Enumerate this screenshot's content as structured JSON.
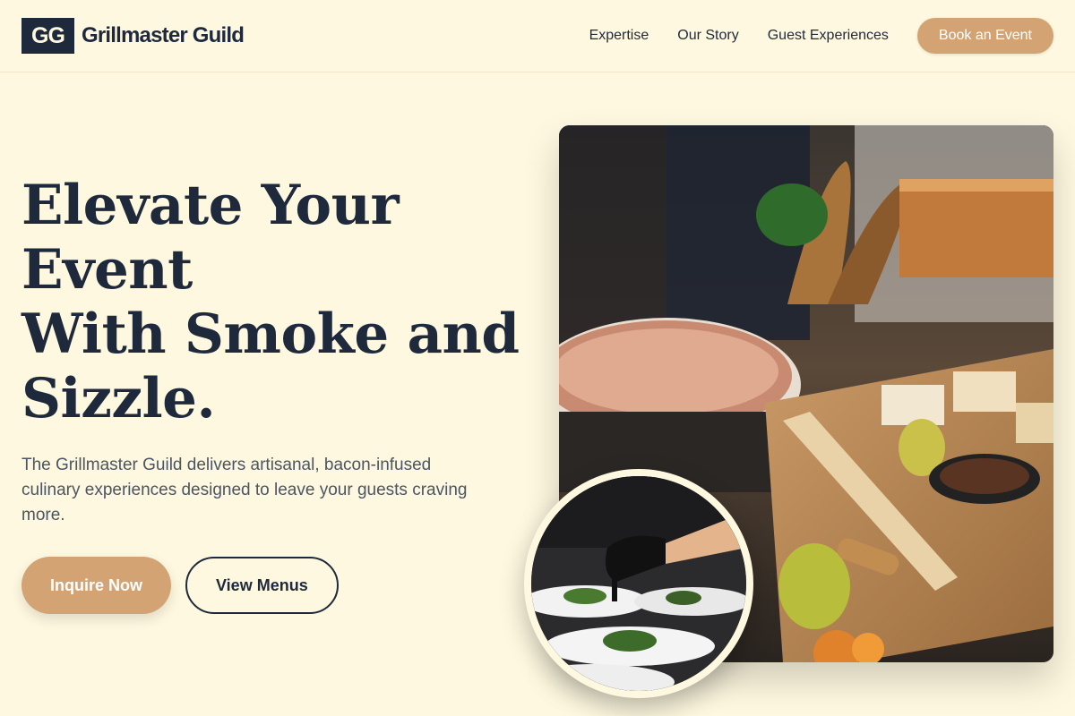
{
  "header": {
    "logo_text": "GG",
    "brand_name": "Grillmaster Guild",
    "nav": [
      "Expertise",
      "Our Story",
      "Guest Experiences"
    ],
    "cta": "Book an Event"
  },
  "hero": {
    "title_lines": [
      "Elevate Your",
      "Event",
      "With Smoke and",
      "Sizzle."
    ],
    "subtitle": "The Grillmaster Guild delivers artisanal, bacon-infused culinary experiences designed to leave your guests craving more.",
    "primary_cta": "Inquire Now",
    "secondary_cta": "View Menus"
  },
  "colors": {
    "background": "#fef8e0",
    "navy": "#1e293b",
    "accent": "#d4a373"
  },
  "images": {
    "main": "catering-grazing-table-photo",
    "inset": "chef-plating-dishes-photo"
  }
}
